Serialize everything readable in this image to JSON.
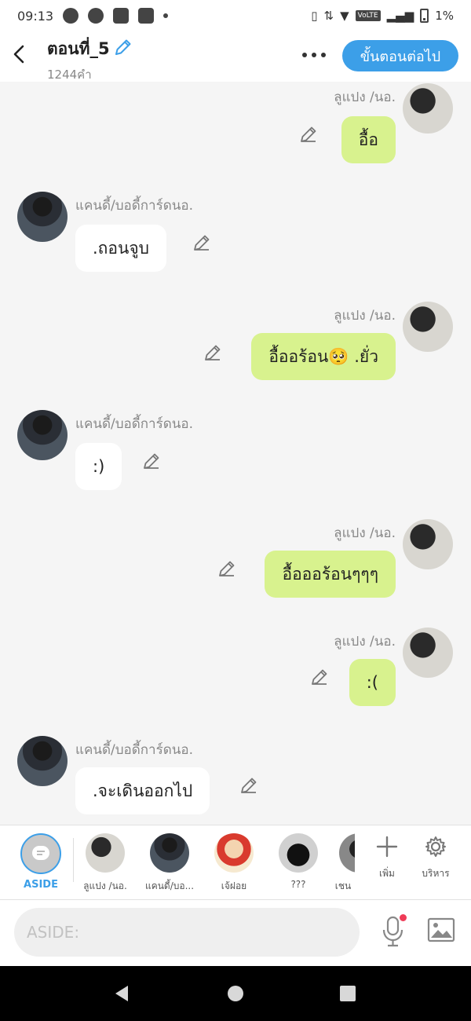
{
  "status_bar": {
    "time": "09:13",
    "network": "VoLTE",
    "battery": "1%"
  },
  "header": {
    "title": "ตอนที่_5",
    "word_count": "1244คำ",
    "next_button": "ขั้นตอนต่อไป"
  },
  "messages": [
    {
      "side": "right",
      "name": "ลูแปง /นอ.",
      "text": "อื้อ"
    },
    {
      "side": "left",
      "name": "แคนดี้/บอดี้การ์ดนอ.",
      "text": ".ถอนจูบ"
    },
    {
      "side": "right",
      "name": "ลูแปง /นอ.",
      "text": "อื้ออร้อน🥺 .ยั่ว"
    },
    {
      "side": "left",
      "name": "แคนดี้/บอดี้การ์ดนอ.",
      "text": ":)"
    },
    {
      "side": "right",
      "name": "ลูแปง /นอ.",
      "text": "อื้อออร้อนๆๆๆ"
    },
    {
      "side": "right",
      "name": "ลูแปง /นอ.",
      "text": ":("
    },
    {
      "side": "left",
      "name": "แคนดี้/บอดี้การ์ดนอ.",
      "text": ".จะเดินออกไป"
    }
  ],
  "characters": {
    "aside_label": "ASIDE",
    "items": [
      {
        "label": "ลูแปง /นอ."
      },
      {
        "label": "แคนดี้/บอ..."
      },
      {
        "label": "เจ้ฝอย"
      },
      {
        "label": "???"
      },
      {
        "label": "เชน"
      }
    ],
    "add_label": "เพิ่ม",
    "manage_label": "บริหาร"
  },
  "composer": {
    "placeholder": "ASIDE:"
  },
  "colors": {
    "accent": "#3c9fe8",
    "right_bubble": "#d8f28e",
    "left_bubble": "#ffffff",
    "notify_dot": "#ef3b57"
  }
}
